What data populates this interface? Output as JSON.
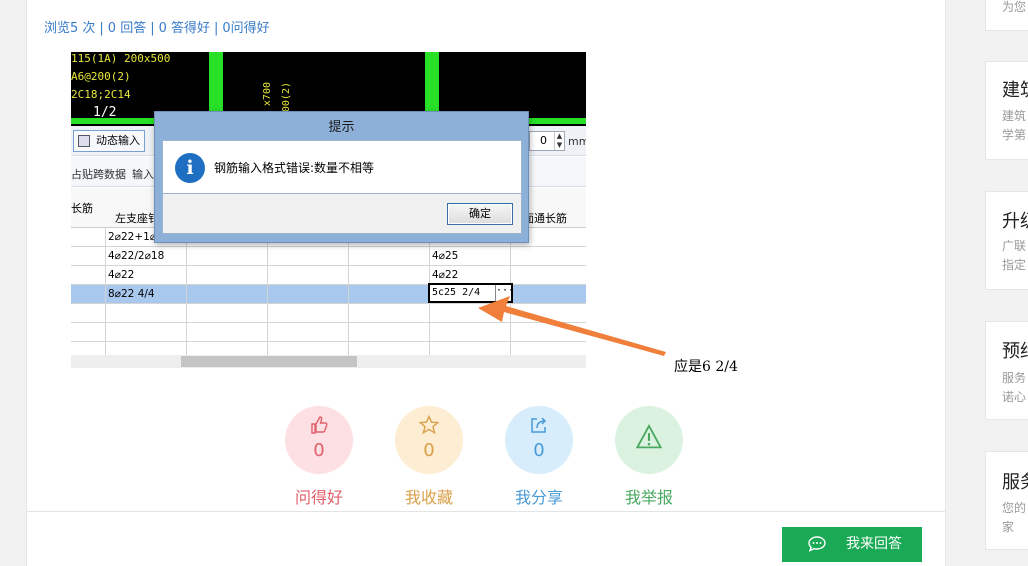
{
  "stats": {
    "views": "浏览5 次",
    "answers": "0 回答",
    "good_answers": "0 答得好",
    "good_questions": "0问得好",
    "separator": "|"
  },
  "screenshot": {
    "cad": {
      "line1": "115(1A) 200x500",
      "line2": "A6@200(2)",
      "line3": "2C18;2C14",
      "span_label": "1/2",
      "vertical1": "x700",
      "vertical2": "200(2)"
    },
    "toolbar": {
      "dynamic_input": "动态输入",
      "spinner_value": "0",
      "unit": "mm"
    },
    "subbar": {
      "paste_span": "占贴跨数据",
      "input": "输入"
    },
    "grid": {
      "headers": {
        "through_bar": "长筋",
        "left_support": "左支座钅",
        "top_through": "面通长筋"
      },
      "rows": [
        {
          "c1": "2⌀22+1⌀",
          "c5": ""
        },
        {
          "c1": "4⌀22/2⌀18",
          "c5": "4⌀25"
        },
        {
          "c1": "4⌀22",
          "c5": "4⌀22"
        },
        {
          "c1": "8⌀22 4/4",
          "c5": ""
        }
      ],
      "edit_value": "5c25 2/4",
      "edit_more": "···"
    },
    "dialog": {
      "title": "提示",
      "icon": "i",
      "message": "钢筋输入格式错误:数量不相等",
      "ok": "确定"
    }
  },
  "annotation": {
    "note": "应是6 2/4",
    "arrow_color": "#f07f3c"
  },
  "actions": [
    {
      "name": "good-question",
      "count": "0",
      "label": "问得好",
      "icon": "thumbs-up-icon",
      "bg": "#fde0e3",
      "fg": "#e0606c"
    },
    {
      "name": "favorite",
      "count": "0",
      "label": "我收藏",
      "icon": "star-icon",
      "bg": "#fdedd2",
      "fg": "#d9a04a"
    },
    {
      "name": "share",
      "count": "0",
      "label": "我分享",
      "icon": "share-icon",
      "bg": "#d8edfb",
      "fg": "#4a9ad6"
    },
    {
      "name": "report",
      "count": "0",
      "label": "我举报",
      "icon": "warning-icon",
      "bg": "#dcf2e0",
      "fg": "#4aa860"
    }
  ],
  "answer_button": {
    "label": "我来回答",
    "color": "#1aaa55"
  },
  "sidebar": {
    "top_fragment": "为您",
    "cards": [
      {
        "title": "建筑",
        "line1": "建筑",
        "line2": "学第"
      },
      {
        "title": "升级",
        "line1": "广联",
        "line2": "指定"
      },
      {
        "title": "预约",
        "line1": "服务",
        "line2": "诺心"
      },
      {
        "title": "服务",
        "line1": "您的",
        "line2": "家"
      }
    ]
  }
}
